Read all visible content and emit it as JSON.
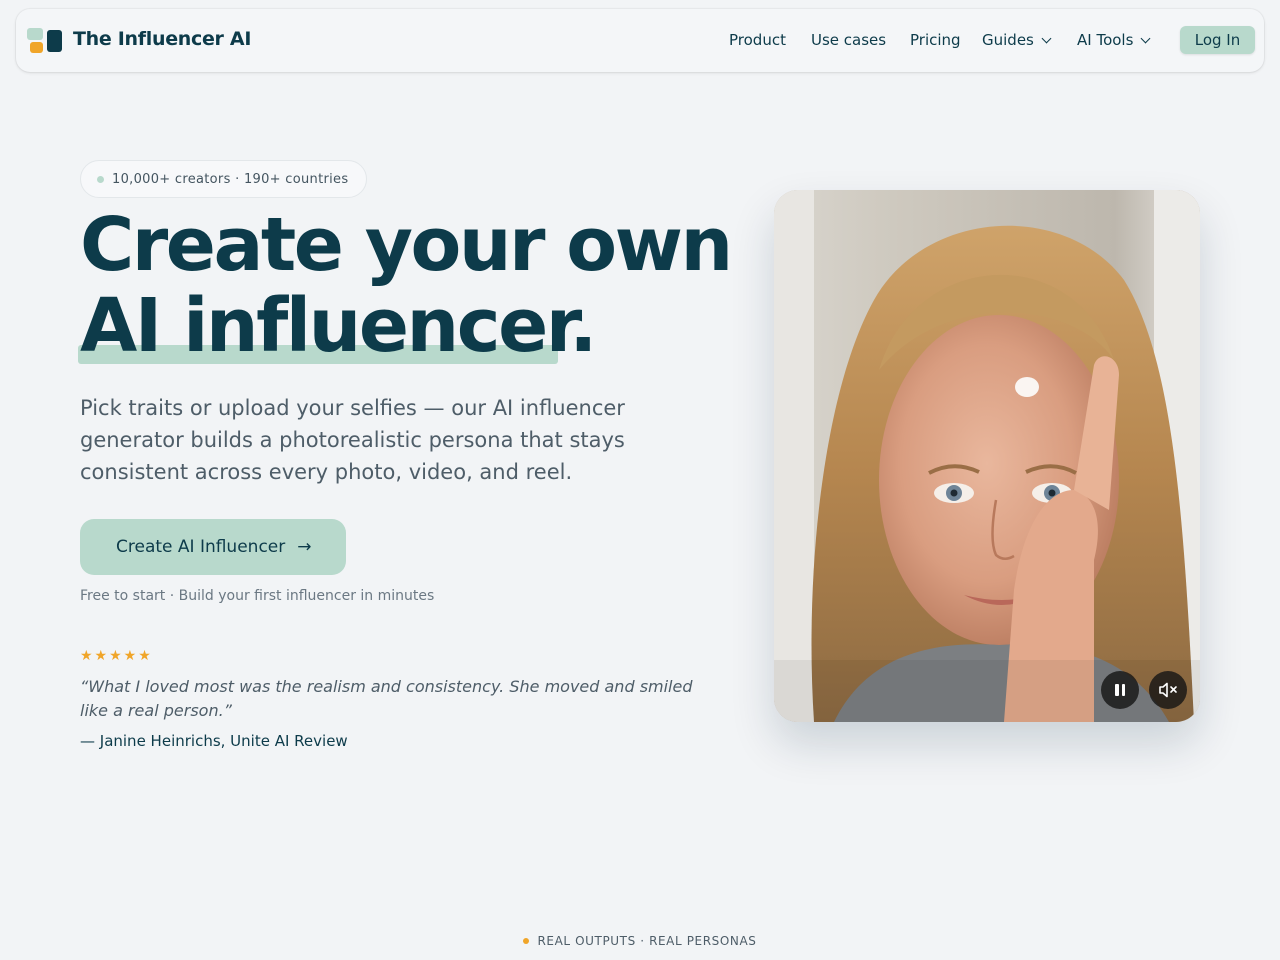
{
  "nav": {
    "brand": "The Influencer AI",
    "links": [
      "Product",
      "Use cases",
      "Pricing",
      "Guides",
      "AI Tools"
    ],
    "login": "Log In"
  },
  "hero": {
    "badge": "10,000+ creators · 190+ countries",
    "title_line1": "Create your own",
    "title_line2": "AI influencer.",
    "subtitle": "Pick traits or upload your selfies — our AI influencer generator builds a photorealistic persona that stays consistent across every photo, video, and reel.",
    "cta": "Create AI Influencer",
    "cta_note": "Free to start · Build your first influencer in minutes",
    "rating_stars": "★★★★★",
    "rating": 5,
    "quote": "“What I loved most was the realism and consistency. She moved and smiled like a real person.”",
    "author": "— Janine Heinrichs, Unite AI Review"
  },
  "video": {
    "state": "playing",
    "muted": true,
    "icons": [
      "pause-icon",
      "mute-icon"
    ]
  },
  "footer": {
    "eyebrow": "REAL OUTPUTS · REAL PERSONAS"
  },
  "colors": {
    "primary": "#0d3b4a",
    "accent_mint": "#b8d9cc",
    "accent_orange": "#f0a529",
    "background": "#f2f4f6"
  }
}
